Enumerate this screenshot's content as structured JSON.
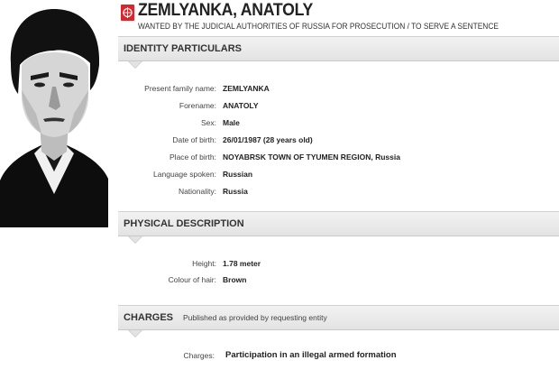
{
  "header": {
    "name": "ZEMLYANKA, ANATOLY",
    "subtitle": "WANTED BY THE JUDICIAL AUTHORITIES OF RUSSIA FOR PROSECUTION / TO SERVE A SENTENCE",
    "logo_color": "#d8262d"
  },
  "identity": {
    "title": "IDENTITY PARTICULARS",
    "fields": [
      {
        "label": "Present family name:",
        "value": "ZEMLYANKA"
      },
      {
        "label": "Forename:",
        "value": "ANATOLY"
      },
      {
        "label": "Sex:",
        "value": "Male"
      },
      {
        "label": "Date of birth:",
        "value": "26/01/1987 (28 years old)"
      },
      {
        "label": "Place of birth:",
        "value": "NOYABRSK TOWN OF TYUMEN REGION, Russia"
      },
      {
        "label": "Language spoken:",
        "value": "Russian"
      },
      {
        "label": "Nationality:",
        "value": "Russia"
      }
    ]
  },
  "physical": {
    "title": "PHYSICAL DESCRIPTION",
    "fields": [
      {
        "label": "Height:",
        "value": "1.78 meter"
      },
      {
        "label": "Colour of hair:",
        "value": "Brown"
      }
    ]
  },
  "charges": {
    "title": "CHARGES",
    "note": "Published as provided by requesting entity",
    "fields": [
      {
        "label": "Charges:",
        "value": "Participation in an illegal armed formation"
      }
    ]
  }
}
